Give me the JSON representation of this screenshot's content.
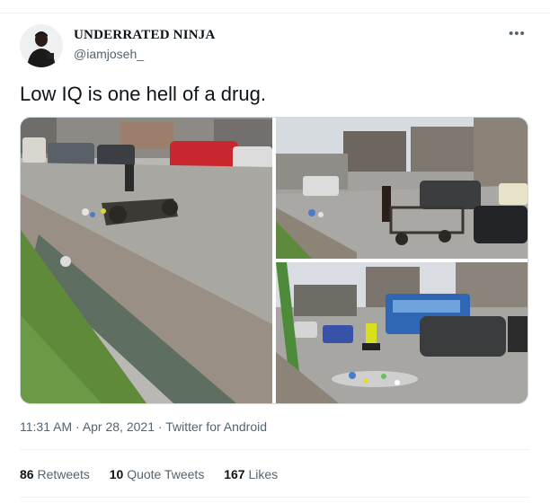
{
  "author": {
    "display_name": "UNDERRATED NINJA",
    "handle": "@iamjoseh_"
  },
  "more_icon": "more-dots-icon",
  "more_glyph": "•••",
  "tweet": {
    "text": "Low IQ is one hell of a drug."
  },
  "media": [
    {
      "name": "photo-1",
      "description_icon": "photo"
    },
    {
      "name": "photo-2",
      "description_icon": "photo"
    },
    {
      "name": "photo-3",
      "description_icon": "photo"
    }
  ],
  "meta": {
    "time": "11:31 AM",
    "sep1": "·",
    "date": "Apr 28, 2021",
    "sep2": "·",
    "source": "Twitter for Android"
  },
  "stats": {
    "retweets_count": "86",
    "retweets_label": "Retweets",
    "quotes_count": "10",
    "quotes_label": "Quote Tweets",
    "likes_count": "167",
    "likes_label": "Likes"
  },
  "colors": {
    "text_primary": "#0f1419",
    "text_secondary": "#536471",
    "border": "#cfd9de"
  }
}
